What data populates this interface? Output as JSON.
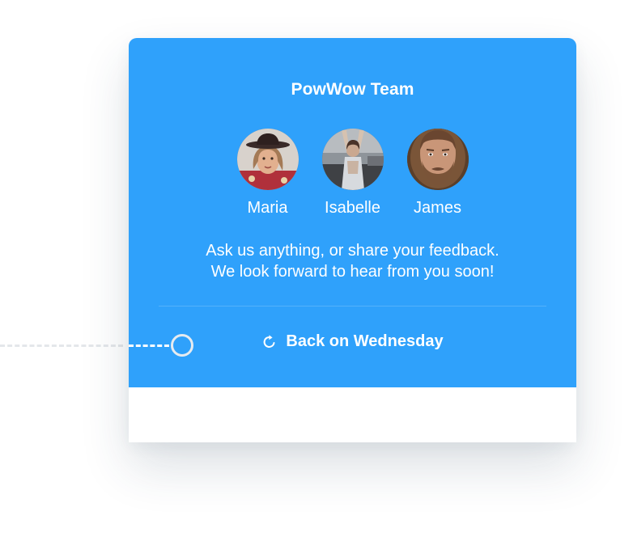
{
  "widget": {
    "title": "PowWow Team",
    "members": [
      {
        "name": "Maria",
        "avatar": "maria-avatar"
      },
      {
        "name": "Isabelle",
        "avatar": "isabelle-avatar"
      },
      {
        "name": "James",
        "avatar": "james-avatar"
      }
    ],
    "message_line1": "Ask us anything, or share your feedback.",
    "message_line2": "We look forward to hear from you soon!",
    "status": "Back on Wednesday",
    "status_icon": "refresh-icon"
  },
  "colors": {
    "header_background": "#2fa1fb",
    "text": "#ffffff",
    "connector": "#e4e7ea"
  }
}
